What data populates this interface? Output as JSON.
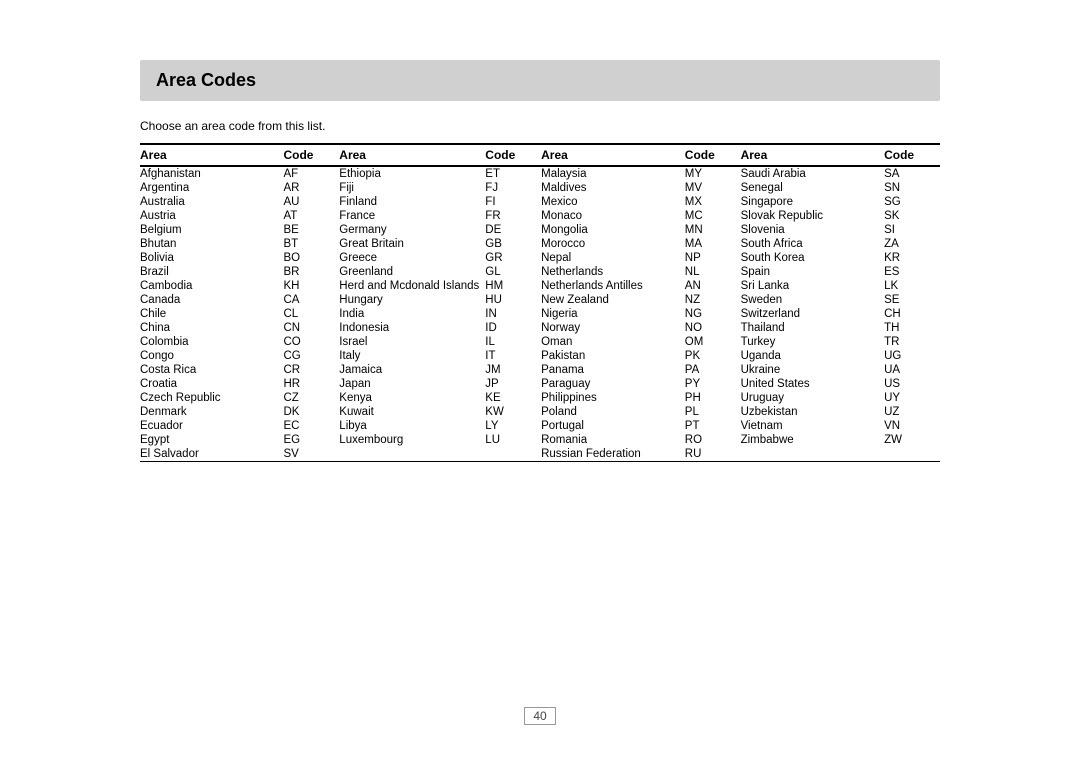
{
  "page": {
    "title": "Area Codes",
    "subtitle": "Choose an area code from this list.",
    "page_number": "40"
  },
  "table": {
    "headers": [
      "Area",
      "Code",
      "Area",
      "Code",
      "Area",
      "Code",
      "Area",
      "Code"
    ],
    "columns": [
      [
        {
          "area": "Afghanistan",
          "code": "AF"
        },
        {
          "area": "Argentina",
          "code": "AR"
        },
        {
          "area": "Australia",
          "code": "AU"
        },
        {
          "area": "Austria",
          "code": "AT"
        },
        {
          "area": "Belgium",
          "code": "BE"
        },
        {
          "area": "Bhutan",
          "code": "BT"
        },
        {
          "area": "Bolivia",
          "code": "BO"
        },
        {
          "area": "Brazil",
          "code": "BR"
        },
        {
          "area": "Cambodia",
          "code": "KH"
        },
        {
          "area": "Canada",
          "code": "CA"
        },
        {
          "area": "Chile",
          "code": "CL"
        },
        {
          "area": "China",
          "code": "CN"
        },
        {
          "area": "Colombia",
          "code": "CO"
        },
        {
          "area": "Congo",
          "code": "CG"
        },
        {
          "area": "Costa Rica",
          "code": "CR"
        },
        {
          "area": "Croatia",
          "code": "HR"
        },
        {
          "area": "Czech Republic",
          "code": "CZ"
        },
        {
          "area": "Denmark",
          "code": "DK"
        },
        {
          "area": "Ecuador",
          "code": "EC"
        },
        {
          "area": "Egypt",
          "code": "EG"
        },
        {
          "area": "El Salvador",
          "code": "SV"
        }
      ],
      [
        {
          "area": "Ethiopia",
          "code": "ET"
        },
        {
          "area": "Fiji",
          "code": "FJ"
        },
        {
          "area": "Finland",
          "code": "FI"
        },
        {
          "area": "France",
          "code": "FR"
        },
        {
          "area": "Germany",
          "code": "DE"
        },
        {
          "area": "Great Britain",
          "code": "GB"
        },
        {
          "area": "Greece",
          "code": "GR"
        },
        {
          "area": "Greenland",
          "code": "GL"
        },
        {
          "area": "Herd and Mcdonald Islands",
          "code": "HM"
        },
        {
          "area": "Hungary",
          "code": "HU"
        },
        {
          "area": "India",
          "code": "IN"
        },
        {
          "area": "Indonesia",
          "code": "ID"
        },
        {
          "area": "Israel",
          "code": "IL"
        },
        {
          "area": "Italy",
          "code": "IT"
        },
        {
          "area": "Jamaica",
          "code": "JM"
        },
        {
          "area": "Japan",
          "code": "JP"
        },
        {
          "area": "Kenya",
          "code": "KE"
        },
        {
          "area": "Kuwait",
          "code": "KW"
        },
        {
          "area": "Libya",
          "code": "LY"
        },
        {
          "area": "Luxembourg",
          "code": "LU"
        },
        {
          "area": "",
          "code": ""
        }
      ],
      [
        {
          "area": "Malaysia",
          "code": "MY"
        },
        {
          "area": "Maldives",
          "code": "MV"
        },
        {
          "area": "Mexico",
          "code": "MX"
        },
        {
          "area": "Monaco",
          "code": "MC"
        },
        {
          "area": "Mongolia",
          "code": "MN"
        },
        {
          "area": "Morocco",
          "code": "MA"
        },
        {
          "area": "Nepal",
          "code": "NP"
        },
        {
          "area": "Netherlands",
          "code": "NL"
        },
        {
          "area": "Netherlands Antilles",
          "code": "AN"
        },
        {
          "area": "New Zealand",
          "code": "NZ"
        },
        {
          "area": "Nigeria",
          "code": "NG"
        },
        {
          "area": "Norway",
          "code": "NO"
        },
        {
          "area": "Oman",
          "code": "OM"
        },
        {
          "area": "Pakistan",
          "code": "PK"
        },
        {
          "area": "Panama",
          "code": "PA"
        },
        {
          "area": "Paraguay",
          "code": "PY"
        },
        {
          "area": "Philippines",
          "code": "PH"
        },
        {
          "area": "Poland",
          "code": "PL"
        },
        {
          "area": "Portugal",
          "code": "PT"
        },
        {
          "area": "Romania",
          "code": "RO"
        },
        {
          "area": "Russian Federation",
          "code": "RU"
        }
      ],
      [
        {
          "area": "Saudi Arabia",
          "code": "SA"
        },
        {
          "area": "Senegal",
          "code": "SN"
        },
        {
          "area": "Singapore",
          "code": "SG"
        },
        {
          "area": "Slovak Republic",
          "code": "SK"
        },
        {
          "area": "Slovenia",
          "code": "SI"
        },
        {
          "area": "South Africa",
          "code": "ZA"
        },
        {
          "area": "South Korea",
          "code": "KR"
        },
        {
          "area": "Spain",
          "code": "ES"
        },
        {
          "area": "Sri Lanka",
          "code": "LK"
        },
        {
          "area": "Sweden",
          "code": "SE"
        },
        {
          "area": "Switzerland",
          "code": "CH"
        },
        {
          "area": "Thailand",
          "code": "TH"
        },
        {
          "area": "Turkey",
          "code": "TR"
        },
        {
          "area": "Uganda",
          "code": "UG"
        },
        {
          "area": "Ukraine",
          "code": "UA"
        },
        {
          "area": "United States",
          "code": "US"
        },
        {
          "area": "Uruguay",
          "code": "UY"
        },
        {
          "area": "Uzbekistan",
          "code": "UZ"
        },
        {
          "area": "Vietnam",
          "code": "VN"
        },
        {
          "area": "Zimbabwe",
          "code": "ZW"
        },
        {
          "area": "",
          "code": ""
        }
      ]
    ]
  }
}
